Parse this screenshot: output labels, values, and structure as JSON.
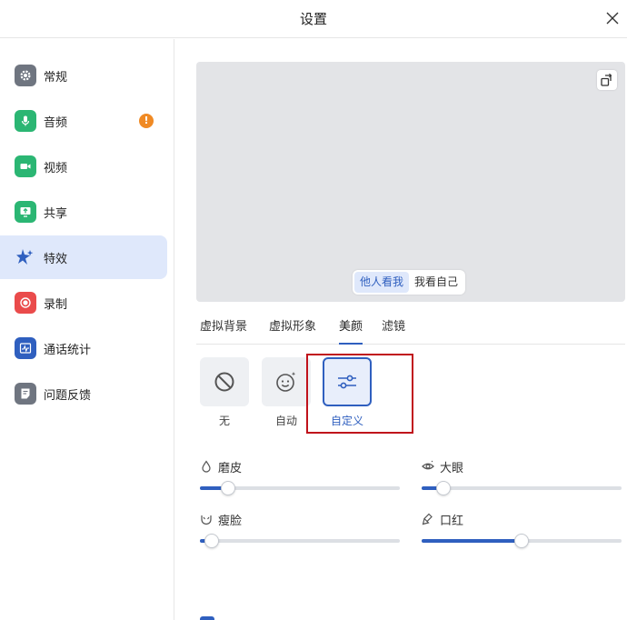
{
  "window": {
    "title": "设置"
  },
  "sidebar": {
    "items": [
      {
        "label": "常规",
        "icon": "gear-icon",
        "color": "#6f7580"
      },
      {
        "label": "音频",
        "icon": "microphone-icon",
        "color": "#2bb673",
        "badge": "!"
      },
      {
        "label": "视频",
        "icon": "video-camera-icon",
        "color": "#2bb673"
      },
      {
        "label": "共享",
        "icon": "share-screen-icon",
        "color": "#2bb673"
      },
      {
        "label": "特效",
        "icon": "sparkle-effects-icon",
        "color": "#2f5fbf"
      },
      {
        "label": "录制",
        "icon": "record-icon",
        "color": "#ea4b4b"
      },
      {
        "label": "通话统计",
        "icon": "call-stats-icon",
        "color": "#2f5fbf"
      },
      {
        "label": "问题反馈",
        "icon": "feedback-icon",
        "color": "#6f7580"
      }
    ]
  },
  "preview": {
    "view_options": [
      "他人看我",
      "我看自己"
    ],
    "selected_view": "他人看我"
  },
  "tabs": [
    "虚拟背景",
    "虚拟形象",
    "美颜",
    "滤镜"
  ],
  "active_tab": "美颜",
  "presets": [
    {
      "label": "无",
      "icon": "ban-icon"
    },
    {
      "label": "自动",
      "icon": "smiley-sparkle-icon"
    },
    {
      "label": "自定义",
      "icon": "sliders-icon"
    }
  ],
  "selected_preset": "自定义",
  "sliders": [
    {
      "label": "磨皮",
      "icon": "droplet-icon",
      "value": 0.14
    },
    {
      "label": "大眼",
      "icon": "eye-icon",
      "value": 0.11
    },
    {
      "label": "瘦脸",
      "icon": "face-slim-icon",
      "value": 0.06
    },
    {
      "label": "口红",
      "icon": "lipstick-icon",
      "value": 0.5
    }
  ],
  "accent_color": "#2f5fbf"
}
